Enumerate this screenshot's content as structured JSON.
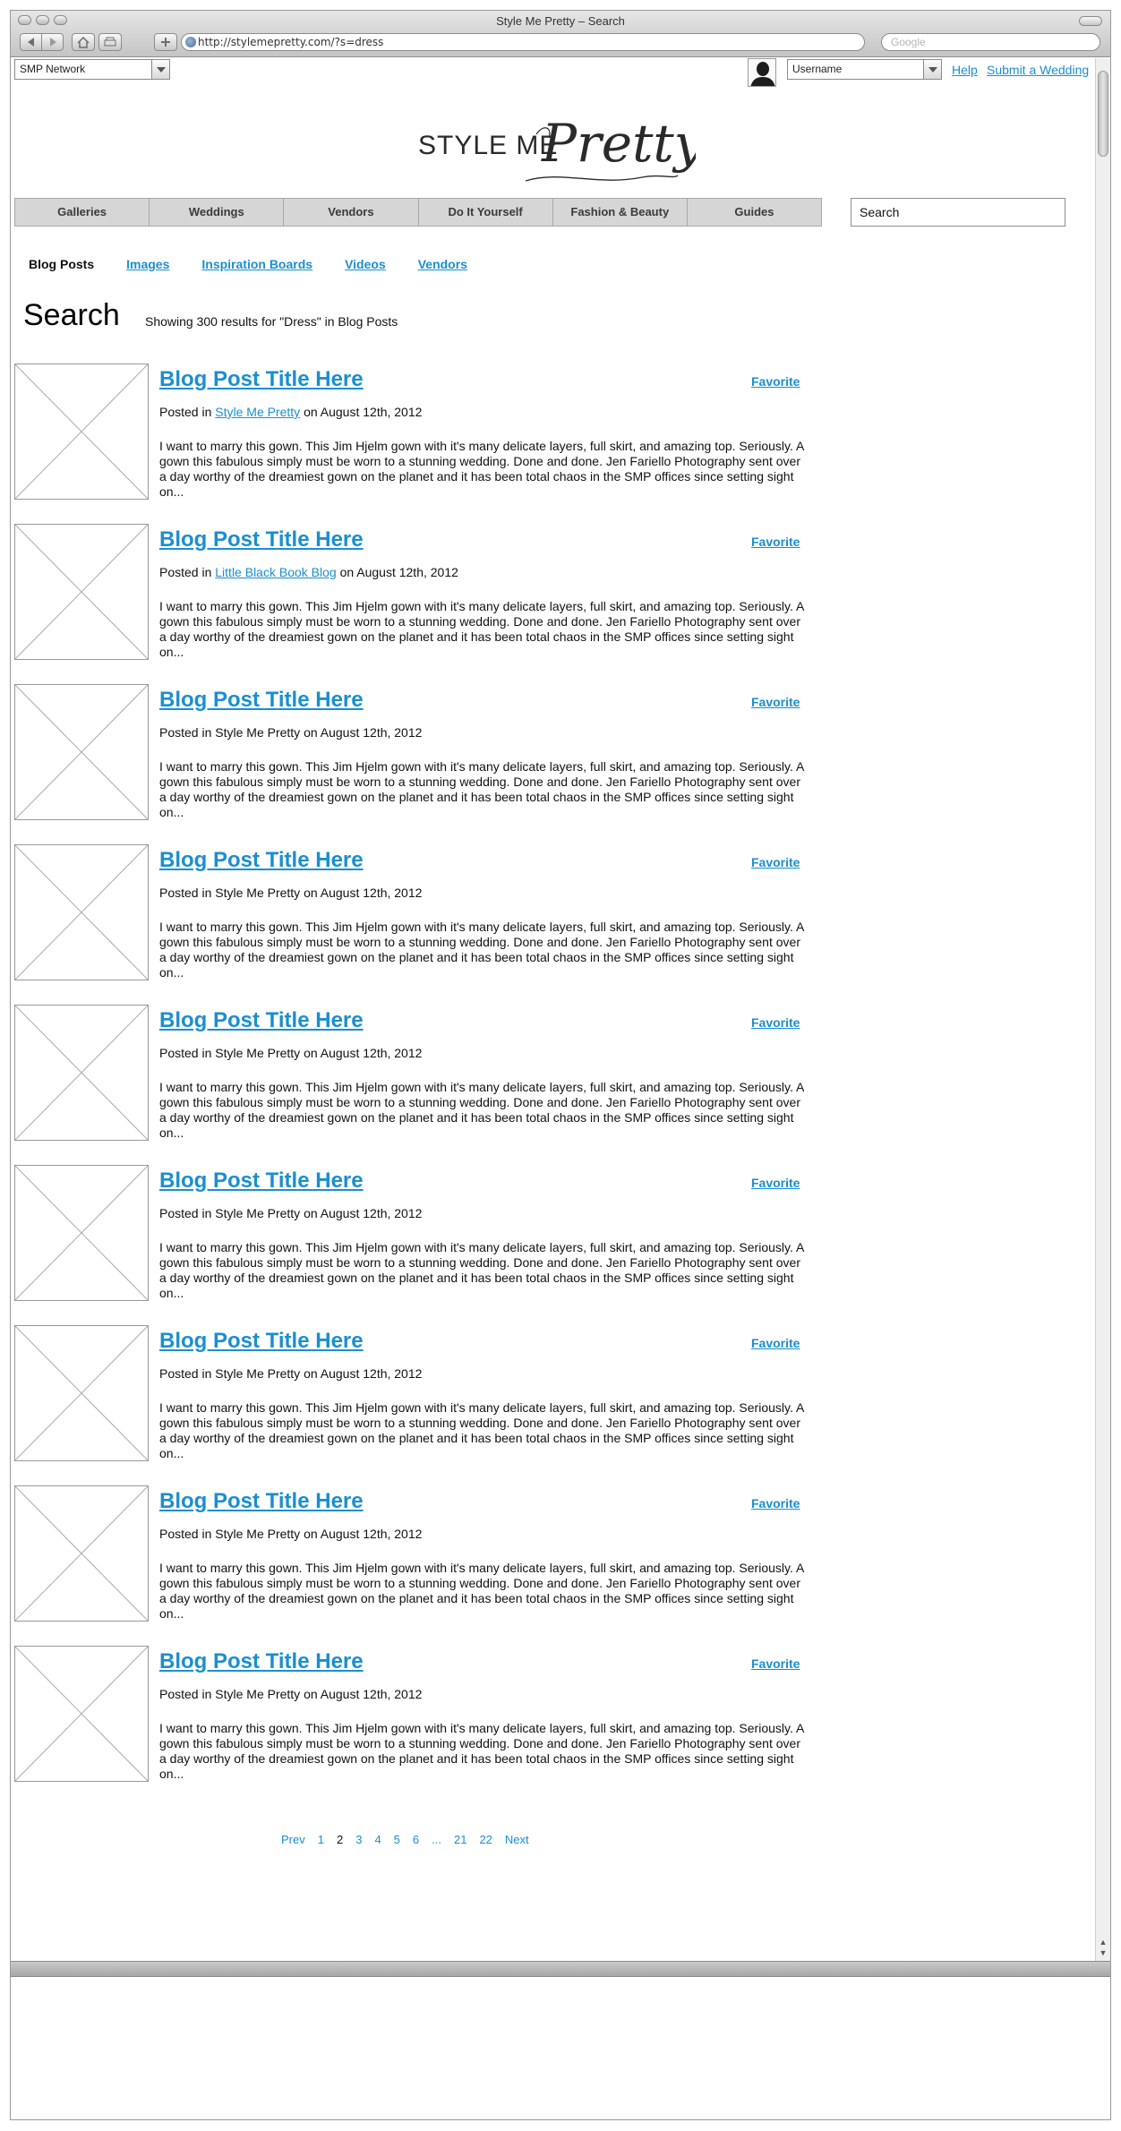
{
  "browser": {
    "window_title": "Style Me Pretty – Search",
    "url": "http://stylemepretty.com/?s=dress",
    "search_placeholder": "Google"
  },
  "header": {
    "network_select": "SMP Network",
    "username_select": "Username",
    "help_link": "Help",
    "submit_link": "Submit a Wedding",
    "logo_text": "STYLE ME Pretty"
  },
  "nav": {
    "items": [
      "Galleries",
      "Weddings",
      "Vendors",
      "Do It Yourself",
      "Fashion & Beauty",
      "Guides"
    ],
    "search_value": "Search"
  },
  "subtabs": [
    "Blog Posts",
    "Images",
    "Inspiration Boards",
    "Videos",
    "Vendors"
  ],
  "search": {
    "heading": "Search",
    "results_info": "Showing 300 results for \"Dress\" in Blog Posts"
  },
  "posts": [
    {
      "title": "Blog Post Title Here",
      "favorite": "Favorite",
      "posted_in": "Posted in",
      "source": "Style Me Pretty",
      "source_linked": true,
      "date": "on August 12th, 2012",
      "excerpt": "I want to marry this gown. This Jim Hjelm gown with it's many delicate layers, full skirt, and amazing top. Seriously. A gown this fabulous simply must be worn to a stunning wedding. Done and done. Jen Fariello Photography sent over a day worthy of the dreamiest gown on the planet and it has been total chaos in the SMP offices since setting sight on..."
    },
    {
      "title": "Blog Post Title Here",
      "favorite": "Favorite",
      "posted_in": "Posted in",
      "source": "Little Black Book Blog",
      "source_linked": true,
      "date": "on August 12th, 2012",
      "excerpt": "I want to marry this gown. This Jim Hjelm gown with it's many delicate layers, full skirt, and amazing top. Seriously. A gown this fabulous simply must be worn to a stunning wedding. Done and done. Jen Fariello Photography sent over a day worthy of the dreamiest gown on the planet and it has been total chaos in the SMP offices since setting sight on..."
    },
    {
      "title": "Blog Post Title Here",
      "favorite": "Favorite",
      "posted_in": "Posted in",
      "source": "Style Me Pretty",
      "source_linked": false,
      "date": "on August 12th, 2012",
      "excerpt": "I want to marry this gown. This Jim Hjelm gown with it's many delicate layers, full skirt, and amazing top. Seriously. A gown this fabulous simply must be worn to a stunning wedding. Done and done. Jen Fariello Photography sent over a day worthy of the dreamiest gown on the planet and it has been total chaos in the SMP offices since setting sight on..."
    },
    {
      "title": "Blog Post Title Here",
      "favorite": "Favorite",
      "posted_in": "Posted in",
      "source": "Style Me Pretty",
      "source_linked": false,
      "date": "on August 12th, 2012",
      "excerpt": "I want to marry this gown. This Jim Hjelm gown with it's many delicate layers, full skirt, and amazing top. Seriously. A gown this fabulous simply must be worn to a stunning wedding. Done and done. Jen Fariello Photography sent over a day worthy of the dreamiest gown on the planet and it has been total chaos in the SMP offices since setting sight on..."
    },
    {
      "title": "Blog Post Title Here",
      "favorite": "Favorite",
      "posted_in": "Posted in",
      "source": "Style Me Pretty",
      "source_linked": false,
      "date": "on August 12th, 2012",
      "excerpt": "I want to marry this gown. This Jim Hjelm gown with it's many delicate layers, full skirt, and amazing top. Seriously. A gown this fabulous simply must be worn to a stunning wedding. Done and done. Jen Fariello Photography sent over a day worthy of the dreamiest gown on the planet and it has been total chaos in the SMP offices since setting sight on..."
    },
    {
      "title": "Blog Post Title Here",
      "favorite": "Favorite",
      "posted_in": "Posted in",
      "source": "Style Me Pretty",
      "source_linked": false,
      "date": "on August 12th, 2012",
      "excerpt": "I want to marry this gown. This Jim Hjelm gown with it's many delicate layers, full skirt, and amazing top. Seriously. A gown this fabulous simply must be worn to a stunning wedding. Done and done. Jen Fariello Photography sent over a day worthy of the dreamiest gown on the planet and it has been total chaos in the SMP offices since setting sight on..."
    },
    {
      "title": "Blog Post Title Here",
      "favorite": "Favorite",
      "posted_in": "Posted in",
      "source": "Style Me Pretty",
      "source_linked": false,
      "date": "on August 12th, 2012",
      "excerpt": "I want to marry this gown. This Jim Hjelm gown with it's many delicate layers, full skirt, and amazing top. Seriously. A gown this fabulous simply must be worn to a stunning wedding. Done and done. Jen Fariello Photography sent over a day worthy of the dreamiest gown on the planet and it has been total chaos in the SMP offices since setting sight on..."
    },
    {
      "title": "Blog Post Title Here",
      "favorite": "Favorite",
      "posted_in": "Posted in",
      "source": "Style Me Pretty",
      "source_linked": false,
      "date": "on August 12th, 2012",
      "excerpt": "I want to marry this gown. This Jim Hjelm gown with it's many delicate layers, full skirt, and amazing top. Seriously. A gown this fabulous simply must be worn to a stunning wedding. Done and done. Jen Fariello Photography sent over a day worthy of the dreamiest gown on the planet and it has been total chaos in the SMP offices since setting sight on..."
    },
    {
      "title": "Blog Post Title Here",
      "favorite": "Favorite",
      "posted_in": "Posted in",
      "source": "Style Me Pretty",
      "source_linked": false,
      "date": "on August 12th, 2012",
      "excerpt": "I want to marry this gown. This Jim Hjelm gown with it's many delicate layers, full skirt, and amazing top. Seriously. A gown this fabulous simply must be worn to a stunning wedding. Done and done. Jen Fariello Photography sent over a day worthy of the dreamiest gown on the planet and it has been total chaos in the SMP offices since setting sight on..."
    }
  ],
  "pagination": {
    "prev": "Prev",
    "pages": [
      "1",
      "2",
      "3",
      "4",
      "5",
      "6",
      "...",
      "21",
      "22"
    ],
    "current": "2",
    "next": "Next"
  },
  "colors": {
    "link": "#1a8fd0",
    "nav_bg": "#d6d6d6"
  }
}
